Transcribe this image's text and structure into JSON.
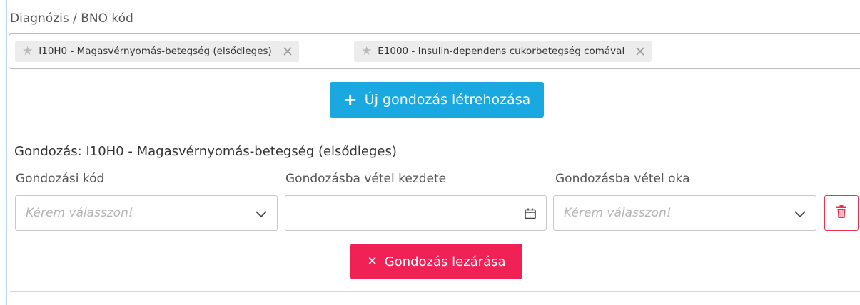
{
  "section_label": "Diagnózis / BNO kód",
  "diagnoses": [
    {
      "label": "I10H0 - Magasvérnyomás-betegség (elsődleges)",
      "icon": "star-icon",
      "remove_icon": "close-icon"
    },
    {
      "label": "E1000 - Insulin-dependens cukorbetegség comával",
      "icon": "star-icon",
      "remove_icon": "close-icon"
    }
  ],
  "new_care_button": "Új gondozás létrehozása",
  "care": {
    "title": "Gondozás: I10H0 - Magasvérnyomás-betegség (elsődleges)",
    "fields": {
      "code_label": "Gondozási kód",
      "code_placeholder": "Kérem válasszon!",
      "start_label": "Gondozásba vétel kezdete",
      "start_value": "",
      "reason_label": "Gondozásba vétel oka",
      "reason_placeholder": "Kérem válasszon!"
    },
    "close_button": "Gondozás lezárása"
  },
  "colors": {
    "primary": "#1aa8e1",
    "danger": "#ef2155",
    "chip_bg": "#ececec"
  }
}
